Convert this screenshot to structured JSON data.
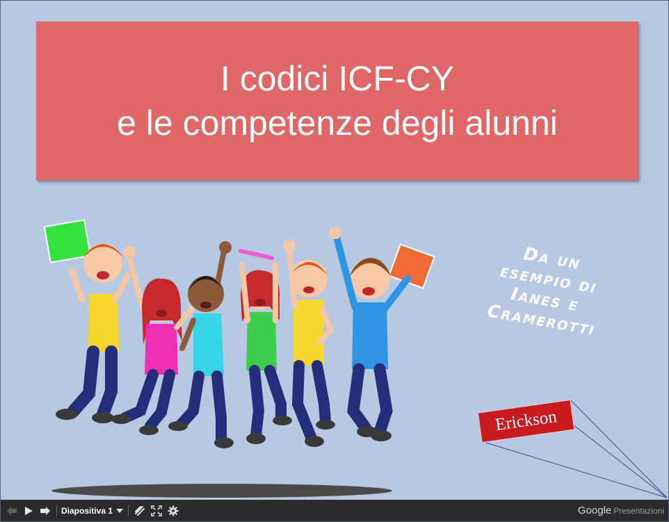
{
  "slide": {
    "title_line1": "I codici ICF-CY",
    "title_line2": "e le competenze degli alunni",
    "handwritten_lines": [
      "Da un",
      "esempio di",
      "Ianes e",
      "Cramerotti"
    ],
    "logo_text": "Erickson",
    "colors": {
      "background": "#b7c9e2",
      "title_box": "#e06767",
      "logo": "#c81a1f"
    }
  },
  "controls": {
    "prev_icon": "arrow-left-icon",
    "play_icon": "play-icon",
    "next_icon": "arrow-right-icon",
    "slide_label": "Diapositiva 1",
    "dropdown_icon": "caret-down-icon",
    "laser_icon": "laser-pointer-icon",
    "fullscreen_icon": "fullscreen-icon",
    "settings_icon": "gear-icon",
    "brand_google": "Google",
    "brand_product": "Presentazioni"
  }
}
